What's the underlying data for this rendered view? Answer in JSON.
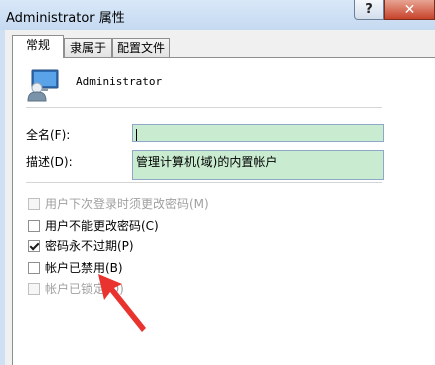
{
  "window": {
    "title": "Administrator 属性",
    "help_symbol": "?",
    "close_symbol": "✕"
  },
  "tabs": [
    {
      "label": "常规",
      "active": true
    },
    {
      "label": "隶属于",
      "active": false
    },
    {
      "label": "配置文件",
      "active": false
    }
  ],
  "user": {
    "name": "Administrator",
    "icon": "user-icon"
  },
  "fields": {
    "fullname_label": "全名(F):",
    "fullname_value": "",
    "description_label": "描述(D):",
    "description_value": "管理计算机(域)的内置帐户"
  },
  "checkboxes": [
    {
      "label": "用户下次登录时须更改密码(M)",
      "checked": false,
      "enabled": false
    },
    {
      "label": "用户不能更改密码(C)",
      "checked": false,
      "enabled": true
    },
    {
      "label": "密码永不过期(P)",
      "checked": true,
      "enabled": true
    },
    {
      "label": "帐户已禁用(B)",
      "checked": false,
      "enabled": true
    },
    {
      "label": "帐户已锁定(O)",
      "checked": false,
      "enabled": false
    }
  ],
  "annotation": {
    "icon": "red-arrow-icon",
    "color": "#e8332f"
  }
}
